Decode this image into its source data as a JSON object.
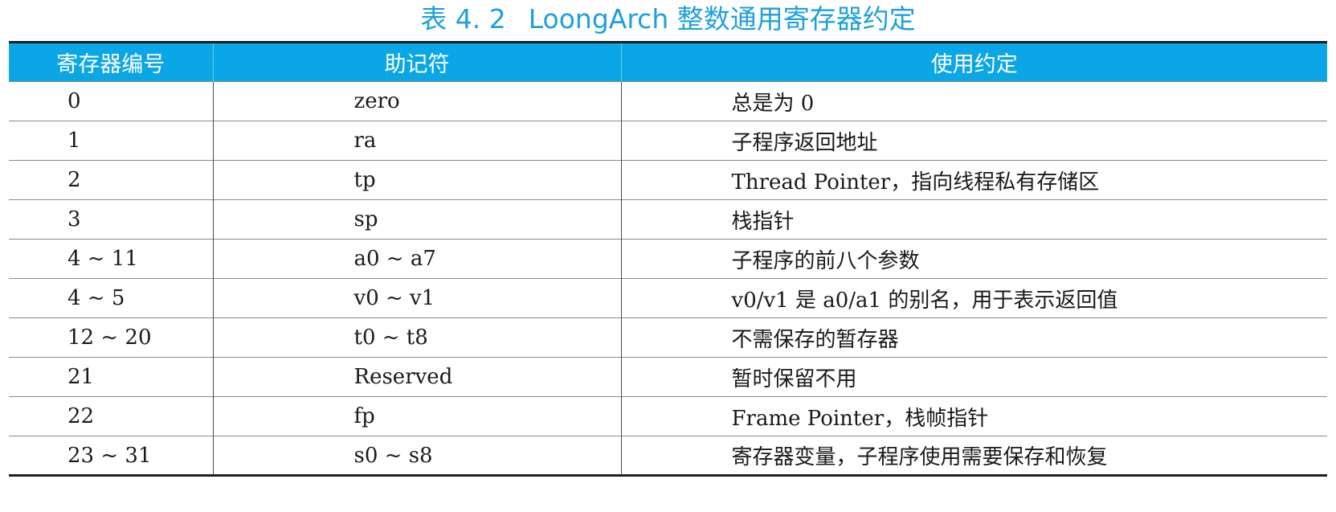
{
  "caption": {
    "number": "表 4. 2",
    "title": "LoongArch 整数通用寄存器约定"
  },
  "colors": {
    "caption_text": "#1ea0dc",
    "header_bg": "#0aa6e6",
    "header_text": "#ffffff"
  },
  "table": {
    "headers": [
      "寄存器编号",
      "助记符",
      "使用约定"
    ],
    "rows": [
      {
        "num": "0",
        "mnemonic": "zero",
        "usage": "总是为 0"
      },
      {
        "num": "1",
        "mnemonic": "ra",
        "usage": "子程序返回地址"
      },
      {
        "num": "2",
        "mnemonic": "tp",
        "usage": "Thread Pointer，指向线程私有存储区"
      },
      {
        "num": "3",
        "mnemonic": "sp",
        "usage": "栈指针"
      },
      {
        "num": "4 ~ 11",
        "mnemonic": "a0 ~ a7",
        "usage": "子程序的前八个参数"
      },
      {
        "num": "4 ~ 5",
        "mnemonic": "v0 ~ v1",
        "usage": "v0/v1 是 a0/a1 的别名，用于表示返回值"
      },
      {
        "num": "12 ~ 20",
        "mnemonic": "t0 ~ t8",
        "usage": "不需保存的暂存器"
      },
      {
        "num": "21",
        "mnemonic": "Reserved",
        "usage": "暂时保留不用"
      },
      {
        "num": "22",
        "mnemonic": "fp",
        "usage": "Frame Pointer，栈帧指针"
      },
      {
        "num": "23 ~ 31",
        "mnemonic": "s0 ~ s8",
        "usage": "寄存器变量，子程序使用需要保存和恢复"
      }
    ]
  }
}
